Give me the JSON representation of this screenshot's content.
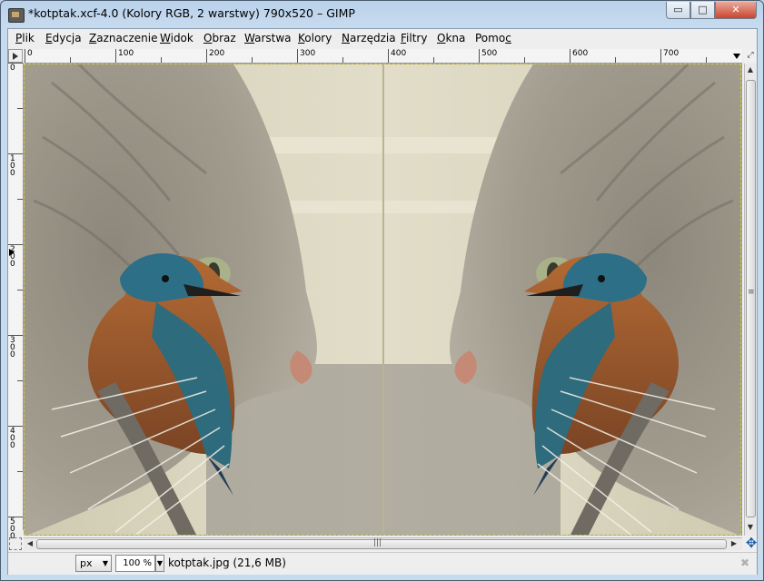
{
  "window": {
    "title": "*kotptak.xcf-4.0 (Kolory RGB, 2 warstwy) 790x520 – GIMP",
    "min_glyph": "▭",
    "max_glyph": "□",
    "close_glyph": "✕"
  },
  "menu": [
    {
      "key": "P",
      "rest": "lik"
    },
    {
      "key": "E",
      "rest": "dycja"
    },
    {
      "key": "Z",
      "rest": "aznaczenie"
    },
    {
      "key": "W",
      "rest": "idok"
    },
    {
      "key": "O",
      "rest": "braz"
    },
    {
      "key": "W",
      "rest": "arstwa"
    },
    {
      "key": "K",
      "rest": "olory"
    },
    {
      "key": "N",
      "rest": "arzędzia"
    },
    {
      "key": "F",
      "rest": "iltry"
    },
    {
      "key": "O",
      "rest": "kna"
    },
    {
      "pre": "Pomo",
      "key": "c",
      "rest": ""
    }
  ],
  "rulers": {
    "horizontal": [
      "0",
      "100",
      "200",
      "300",
      "400",
      "500",
      "600",
      "700"
    ],
    "vertical": [
      "0",
      "100",
      "200",
      "300",
      "400",
      "500"
    ]
  },
  "status": {
    "unit": "px",
    "zoom": "100 %",
    "file_info": "kotptak.jpg (21,6 MB)"
  },
  "icons": {
    "app": "gimp-wilber-icon",
    "ruler_corner": "triangle-menu-icon",
    "navigation_corner": "zoom-fit-icon",
    "navigate": "navigate-cross-icon",
    "cancel": "cancel-icon"
  }
}
